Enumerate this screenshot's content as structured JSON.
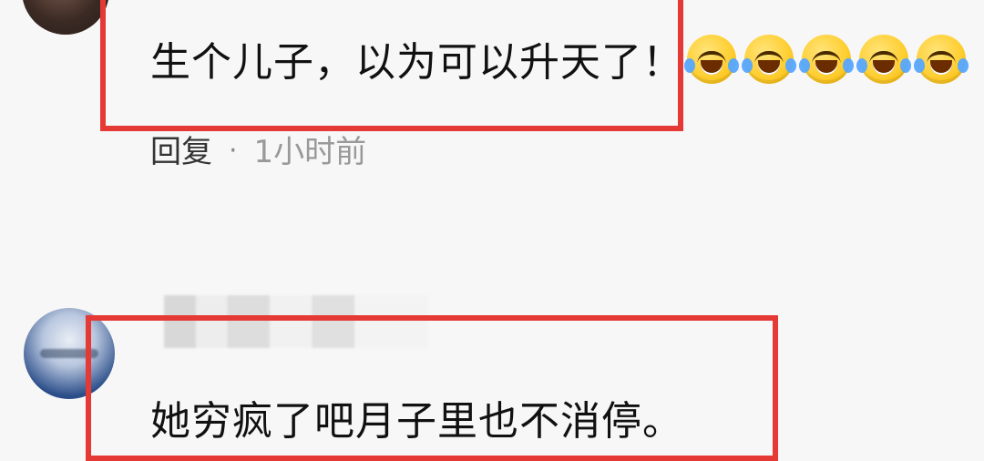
{
  "comments": [
    {
      "text": "生个儿子，以为可以升天了！",
      "meta": {
        "reply_label": "回复",
        "separator": "·",
        "time_ago": "1小时前"
      },
      "emoji_icons": [
        "laughing-tears-emoji-icon",
        "laughing-tears-emoji-icon",
        "laughing-tears-emoji-icon",
        "laughing-tears-emoji-icon",
        "laughing-tears-emoji-icon"
      ]
    },
    {
      "text": "她穷疯了吧月子里也不消停。"
    }
  ],
  "colors": {
    "highlight_border": "#e53935",
    "background": "#f7f7f7"
  }
}
